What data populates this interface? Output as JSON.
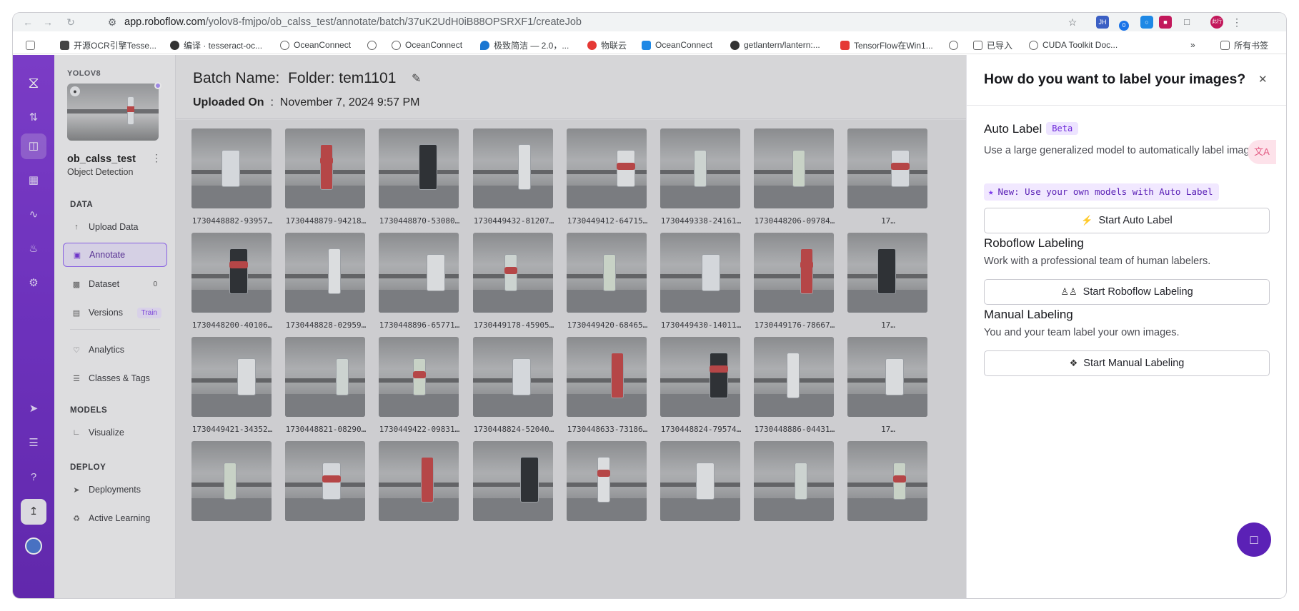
{
  "browser": {
    "url_host": "app.roboflow.com",
    "url_path": "/yolov8-fmjpo/ob_calss_test/annotate/batch/37uK2UdH0iB88OPSRXF1/createJob",
    "extension_badge": "0",
    "extension_jh": "JH",
    "profile_text": "此行",
    "bookmarks": [
      "开源OCR引擎Tesse...",
      "编译 · tesseract-oc...",
      "OceanConnect",
      "OceanConnect",
      "极致简洁 — 2.0，...",
      "物联云",
      "OceanConnect",
      "getlantern/lantern:...",
      "TensorFlow在Win1...",
      "已导入",
      "CUDA Toolkit Doc..."
    ],
    "bookmarks_overflow": "»",
    "all_bookmarks": "所有书签"
  },
  "sidebar": {
    "workspace_tag": "YOLOV8",
    "project_name": "ob_calss_test",
    "project_type": "Object Detection",
    "data_heading": "DATA",
    "models_heading": "MODELS",
    "deploy_heading": "DEPLOY",
    "items": [
      {
        "label": "Upload Data"
      },
      {
        "label": "Annotate"
      },
      {
        "label": "Dataset",
        "badge": "0"
      },
      {
        "label": "Versions",
        "badge": "Train"
      },
      {
        "label": "Analytics"
      },
      {
        "label": "Classes & Tags"
      },
      {
        "label": "Visualize"
      },
      {
        "label": "Deployments"
      },
      {
        "label": "Active Learning"
      }
    ]
  },
  "header": {
    "batch_label": "Batch Name:",
    "batch_value": "Folder: tem1101",
    "uploaded_label": "Uploaded On",
    "uploaded_sep": ":",
    "uploaded_value": "November 7, 2024 9:57 PM"
  },
  "grid": {
    "captions": [
      [
        "1730448882-93957…",
        "1730448879-94218…",
        "1730448870-53080…",
        "1730449432-81207…",
        "1730449412-64715…",
        "1730449338-24161…",
        "1730448206-09784…",
        "17…"
      ],
      [
        "1730448200-40106…",
        "1730448828-02959…",
        "1730448896-65771…",
        "1730449178-45905…",
        "1730449420-68465…",
        "1730449430-14011…",
        "1730449176-78667…",
        "17…"
      ],
      [
        "1730449421-34352…",
        "1730448821-08290…",
        "1730449422-09831…",
        "1730448824-52040…",
        "1730448633-73186…",
        "1730448824-79574…",
        "1730448886-04431…",
        "17…"
      ],
      [
        "",
        "",
        "",
        "",
        "",
        "",
        "",
        ""
      ]
    ]
  },
  "panel": {
    "title": "How do you want to label your images?",
    "auto": {
      "heading": "Auto Label",
      "badge": "Beta",
      "desc": "Use a large generalized model to automatically label images.",
      "chip": "New: Use your own models with Auto Label",
      "button": "Start Auto Label"
    },
    "roboflow": {
      "heading": "Roboflow Labeling",
      "desc": "Work with a professional team of human labelers.",
      "button": "Start Roboflow Labeling"
    },
    "manual": {
      "heading": "Manual Labeling",
      "desc": "You and your team label your own images.",
      "button": "Start Manual Labeling"
    }
  },
  "colors": {
    "brand": "#6a22c9",
    "accent": "#7c3aed",
    "active_bg": "#eae3fb"
  },
  "icons": {
    "back": "back-arrow-icon",
    "forward": "forward-arrow-icon",
    "reload": "reload-icon",
    "star": "bookmark-star-icon",
    "close": "close-icon",
    "edit": "pencil-icon",
    "chat": "chat-icon"
  }
}
